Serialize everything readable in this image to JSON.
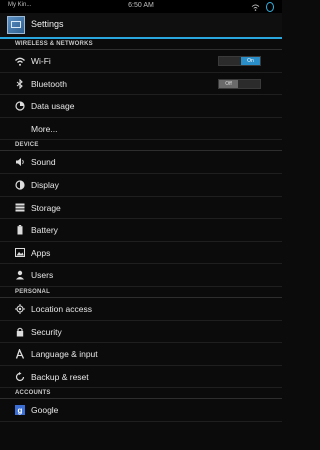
{
  "statusbar": {
    "carrier": "My Kin...",
    "time": "6:50 AM"
  },
  "actionbar": {
    "title": "Settings"
  },
  "sections": [
    {
      "header": "WIRELESS & NETWORKS",
      "items": [
        {
          "label": "Wi-Fi",
          "icon": "wifi-icon",
          "toggle": "On"
        },
        {
          "label": "Bluetooth",
          "icon": "bluetooth-icon",
          "toggle": "Off"
        },
        {
          "label": "Data usage",
          "icon": "data-usage-icon"
        },
        {
          "label": "More...",
          "icon": ""
        }
      ]
    },
    {
      "header": "DEVICE",
      "items": [
        {
          "label": "Sound",
          "icon": "sound-icon"
        },
        {
          "label": "Display",
          "icon": "display-icon"
        },
        {
          "label": "Storage",
          "icon": "storage-icon"
        },
        {
          "label": "Battery",
          "icon": "battery-icon"
        },
        {
          "label": "Apps",
          "icon": "apps-icon"
        },
        {
          "label": "Users",
          "icon": "users-icon"
        }
      ]
    },
    {
      "header": "PERSONAL",
      "items": [
        {
          "label": "Location access",
          "icon": "location-icon"
        },
        {
          "label": "Security",
          "icon": "lock-icon"
        },
        {
          "label": "Language & input",
          "icon": "language-icon"
        },
        {
          "label": "Backup & reset",
          "icon": "backup-icon"
        }
      ]
    },
    {
      "header": "ACCOUNTS",
      "items": [
        {
          "label": "Google",
          "icon": "google-icon"
        }
      ]
    }
  ],
  "colors": {
    "accent": "#2aa7df",
    "toggle_on": "#2a8fc9",
    "toggle_off": "#6a6a6a",
    "background": "#0b0b0b"
  }
}
